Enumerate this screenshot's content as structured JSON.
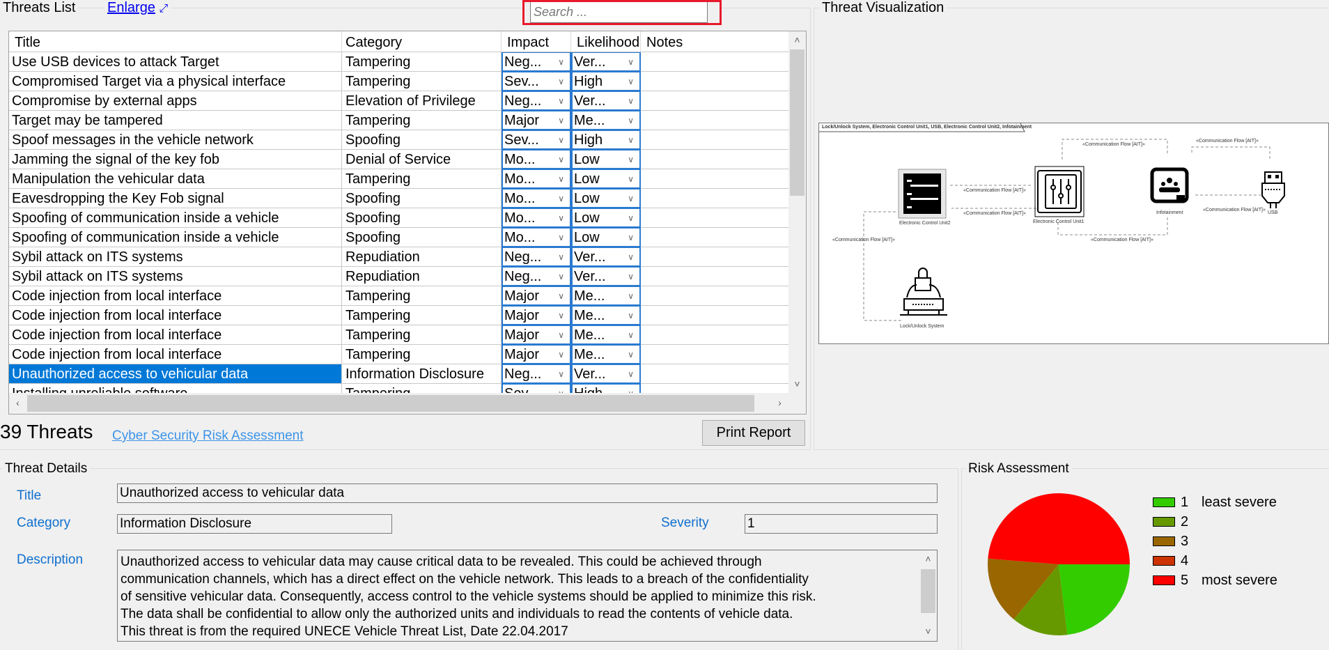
{
  "threats_list": {
    "title": "Threats List",
    "enlarge_label": "Enlarge",
    "enlarge_icon": "expand-arrows-icon",
    "search": {
      "placeholder": "Search ...",
      "value": ""
    },
    "columns": [
      "Title",
      "Category",
      "Impact",
      "Likelihood",
      "Notes"
    ],
    "rows": [
      {
        "title": "Use USB devices to attack Target",
        "category": "Tampering",
        "impact": "Neg...",
        "likelihood": "Ver...",
        "notes": ""
      },
      {
        "title": "Compromised  Target via a physical interface",
        "category": "Tampering",
        "impact": "Sev...",
        "likelihood": "High",
        "notes": ""
      },
      {
        "title": "Compromise by external apps",
        "category": "Elevation of Privilege",
        "impact": "Neg...",
        "likelihood": "Ver...",
        "notes": ""
      },
      {
        "title": "Target may be tampered",
        "category": "Tampering",
        "impact": "Major",
        "likelihood": "Me...",
        "notes": ""
      },
      {
        "title": "Spoof messages in the vehicle network",
        "category": "Spoofing",
        "impact": "Sev...",
        "likelihood": "High",
        "notes": ""
      },
      {
        "title": "Jamming the signal of the key fob",
        "category": "Denial of Service",
        "impact": "Mo...",
        "likelihood": "Low",
        "notes": ""
      },
      {
        "title": "Manipulation the vehicular data",
        "category": "Tampering",
        "impact": "Mo...",
        "likelihood": "Low",
        "notes": ""
      },
      {
        "title": "Eavesdropping the Key Fob signal",
        "category": "Spoofing",
        "impact": "Mo...",
        "likelihood": "Low",
        "notes": ""
      },
      {
        "title": "Spoofing of communication inside a vehicle",
        "category": "Spoofing",
        "impact": "Mo...",
        "likelihood": "Low",
        "notes": ""
      },
      {
        "title": "Spoofing of communication inside a vehicle",
        "category": "Spoofing",
        "impact": "Mo...",
        "likelihood": "Low",
        "notes": ""
      },
      {
        "title": "Sybil attack on ITS systems",
        "category": "Repudiation",
        "impact": "Neg...",
        "likelihood": "Ver...",
        "notes": ""
      },
      {
        "title": "Sybil attack on ITS systems",
        "category": "Repudiation",
        "impact": "Neg...",
        "likelihood": "Ver...",
        "notes": ""
      },
      {
        "title": "Code injection from local interface",
        "category": "Tampering",
        "impact": "Major",
        "likelihood": "Me...",
        "notes": ""
      },
      {
        "title": "Code injection from local interface",
        "category": "Tampering",
        "impact": "Major",
        "likelihood": "Me...",
        "notes": ""
      },
      {
        "title": "Code injection from local interface",
        "category": "Tampering",
        "impact": "Major",
        "likelihood": "Me...",
        "notes": ""
      },
      {
        "title": "Code injection from local interface",
        "category": "Tampering",
        "impact": "Major",
        "likelihood": "Me...",
        "notes": ""
      },
      {
        "title": "Unauthorized access to vehicular data",
        "category": "Information Disclosure",
        "impact": "Neg...",
        "likelihood": "Ver...",
        "notes": "",
        "selected": true
      },
      {
        "title": "Installing unreliable software",
        "category": "Tampering",
        "impact": "Sev...",
        "likelihood": "High",
        "notes": ""
      }
    ],
    "count_label": "39 Threats",
    "risk_link": "Cyber Security Risk Assessment",
    "print_button": "Print Report"
  },
  "visualization": {
    "title": "Threat Visualization",
    "diagram_title": "Lock/Unlock System, Electronic Control Unit1, USB, Electronic Control Unit2, Infotainment",
    "nodes": [
      {
        "label": "Electronic Control Unit2",
        "icon": "server-icon"
      },
      {
        "label": "Electronic Control Unit1",
        "icon": "control-panel-icon"
      },
      {
        "label": "Infotainment",
        "icon": "infotainment-icon"
      },
      {
        "label": "USB",
        "icon": "usb-icon"
      },
      {
        "label": "Lock/Unlock System",
        "icon": "car-lock-icon"
      }
    ],
    "flow_label": "«Communication Flow [AIT]»"
  },
  "details": {
    "title": "Threat Details",
    "title_label": "Title",
    "title_value": "Unauthorized access to vehicular data",
    "category_label": "Category",
    "category_value": "Information Disclosure",
    "severity_label": "Severity",
    "severity_value": "1",
    "description_label": "Description",
    "description_value": "Unauthorized access to vehicular data may cause critical data to be revealed. This could be achieved through\ncommunication channels, which has a direct effect on the vehicle network. This leads to a breach of the confidentiality\nof sensitive vehicular data. Consequently, access control to the vehicle systems should be applied to minimize this risk.\nThe data shall be confidential to allow only the authorized units and individuals to read the contents of vehicle data.\nThis threat is from the required UNECE Vehicle Threat List, Date 22.04.2017"
  },
  "risk": {
    "title": "Risk Assessment",
    "legend": [
      {
        "num": "1",
        "text": "least severe",
        "color": "#33cc00"
      },
      {
        "num": "2",
        "text": "",
        "color": "#669900"
      },
      {
        "num": "3",
        "text": "",
        "color": "#996600"
      },
      {
        "num": "4",
        "text": "",
        "color": "#cc3300"
      },
      {
        "num": "5",
        "text": "most severe",
        "color": "#ff0000"
      }
    ]
  },
  "chart_data": {
    "type": "pie",
    "title": "Risk Assessment",
    "categories": [
      "1",
      "2",
      "3",
      "4",
      "5"
    ],
    "values": [
      9,
      5,
      6,
      0,
      19
    ],
    "colors": [
      "#33cc00",
      "#669900",
      "#996600",
      "#cc3300",
      "#ff0000"
    ],
    "legend_position": "right"
  },
  "colors": {
    "selection": "#0078d7",
    "label_blue": "#0f6fcf",
    "search_highlight": "#e8192c",
    "combo_border": "#2a7ad0"
  }
}
